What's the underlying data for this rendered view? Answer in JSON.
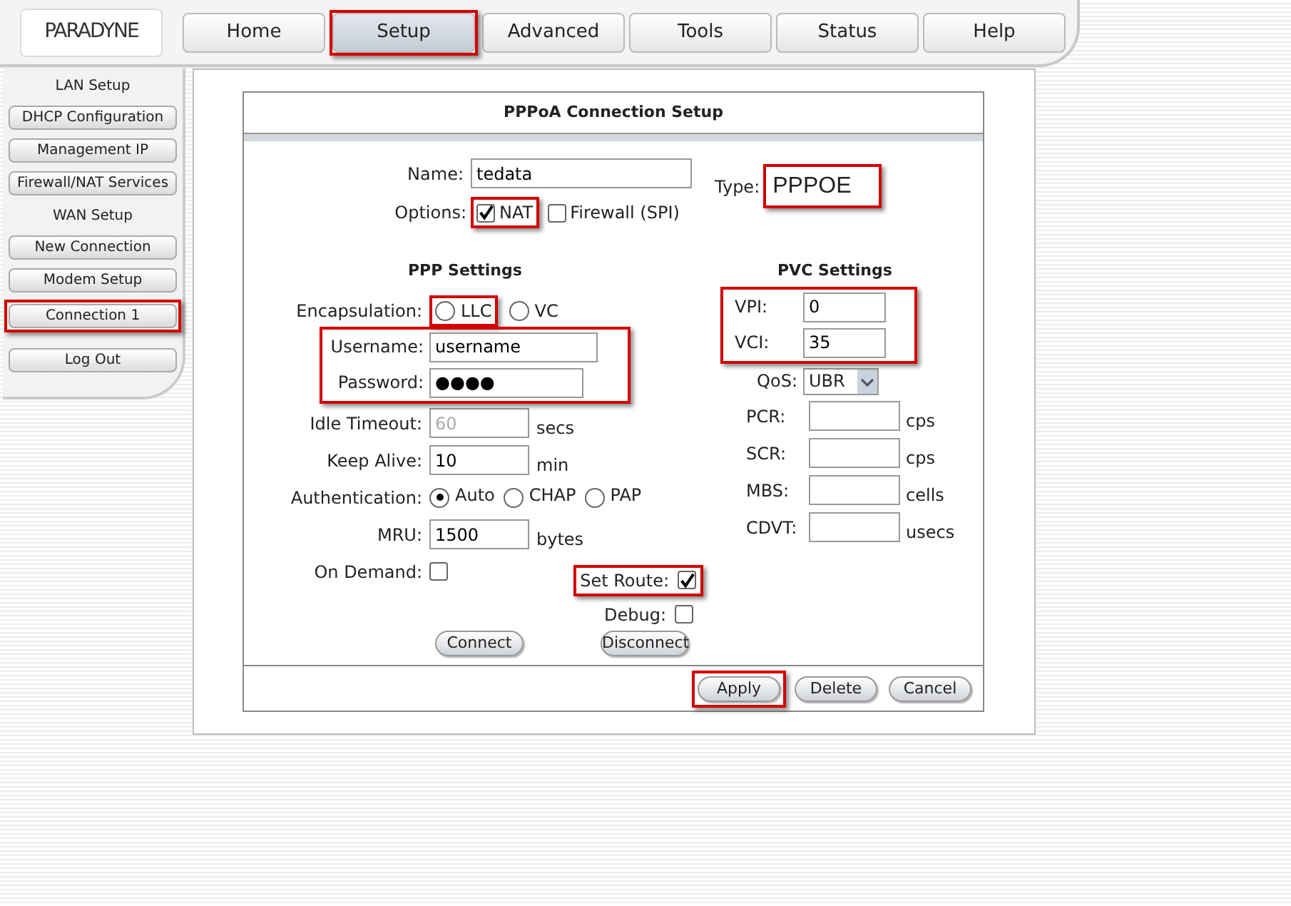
{
  "logo": "PARADYNE",
  "nav_tabs": [
    {
      "label": "Home",
      "selected": false,
      "highlighted": false
    },
    {
      "label": "Setup",
      "selected": true,
      "highlighted": true
    },
    {
      "label": "Advanced",
      "selected": false,
      "highlighted": false
    },
    {
      "label": "Tools",
      "selected": false,
      "highlighted": false
    },
    {
      "label": "Status",
      "selected": false,
      "highlighted": false
    },
    {
      "label": "Help",
      "selected": false,
      "highlighted": false
    }
  ],
  "sidebar": {
    "items": [
      {
        "kind": "heading",
        "label": "LAN Setup"
      },
      {
        "kind": "button",
        "label": "DHCP Configuration",
        "highlighted": false
      },
      {
        "kind": "button",
        "label": "Management IP",
        "highlighted": false
      },
      {
        "kind": "button",
        "label": "Firewall/NAT Services",
        "highlighted": false
      },
      {
        "kind": "heading",
        "label": "WAN Setup"
      },
      {
        "kind": "button",
        "label": "New Connection",
        "highlighted": false
      },
      {
        "kind": "button",
        "label": "Modem Setup",
        "highlighted": false
      },
      {
        "kind": "button",
        "label": "Connection 1",
        "highlighted": true
      },
      {
        "kind": "gap"
      },
      {
        "kind": "button",
        "label": "Log Out",
        "highlighted": false
      }
    ]
  },
  "form": {
    "title": "PPPoA Connection Setup",
    "name": {
      "label": "Name:",
      "value": "tedata"
    },
    "type": {
      "label": "Type:",
      "value": "PPPOE",
      "highlighted": true
    },
    "options": {
      "label": "Options:",
      "checkboxes": [
        {
          "label": "NAT",
          "checked": true,
          "highlighted": true
        },
        {
          "label": "Firewall (SPI)",
          "checked": false,
          "highlighted": false
        }
      ]
    },
    "ppp": {
      "title": "PPP Settings",
      "encapsulation": {
        "label": "Encapsulation:",
        "options": [
          {
            "label": "LLC",
            "selected": false,
            "highlighted": true
          },
          {
            "label": "VC",
            "selected": false,
            "highlighted": false
          }
        ]
      },
      "credentials": {
        "highlighted": true,
        "fields": [
          {
            "label": "Username:",
            "value": "username"
          },
          {
            "label": "Password:",
            "value": "●●●●"
          }
        ]
      },
      "rows": [
        {
          "kind": "input",
          "label": "Idle Timeout:",
          "value": "60",
          "unit": "secs",
          "disabled": true
        },
        {
          "kind": "input",
          "label": "Keep Alive:",
          "value": "10",
          "unit": "min",
          "disabled": false
        },
        {
          "kind": "radio",
          "label": "Authentication:",
          "options": [
            {
              "label": "Auto",
              "selected": true
            },
            {
              "label": "CHAP",
              "selected": false
            },
            {
              "label": "PAP",
              "selected": false
            }
          ]
        },
        {
          "kind": "input",
          "label": "MRU:",
          "value": "1500",
          "unit": "bytes",
          "disabled": false
        },
        {
          "kind": "checkbox",
          "label": "On Demand:",
          "checked": false
        }
      ],
      "flags": [
        {
          "label": "Set Route:",
          "checked": true,
          "highlighted": true
        },
        {
          "label": "Debug:",
          "checked": false,
          "highlighted": false
        }
      ]
    },
    "pvc": {
      "title": "PVC Settings",
      "ids": {
        "highlighted": true,
        "fields": [
          {
            "label": "VPI:",
            "value": "0"
          },
          {
            "label": "VCI:",
            "value": "35"
          }
        ]
      },
      "qos": {
        "label": "QoS:",
        "value": "UBR"
      },
      "rows": [
        {
          "label": "PCR:",
          "value": "",
          "unit": "cps"
        },
        {
          "label": "SCR:",
          "value": "",
          "unit": "cps"
        },
        {
          "label": "MBS:",
          "value": "",
          "unit": "cells"
        },
        {
          "label": "CDVT:",
          "value": "",
          "unit": "usecs"
        }
      ]
    },
    "action_buttons": [
      "Connect",
      "Disconnect"
    ],
    "footer_buttons": [
      {
        "label": "Apply",
        "highlighted": true
      },
      {
        "label": "Delete",
        "highlighted": false
      },
      {
        "label": "Cancel",
        "highlighted": false
      }
    ]
  }
}
